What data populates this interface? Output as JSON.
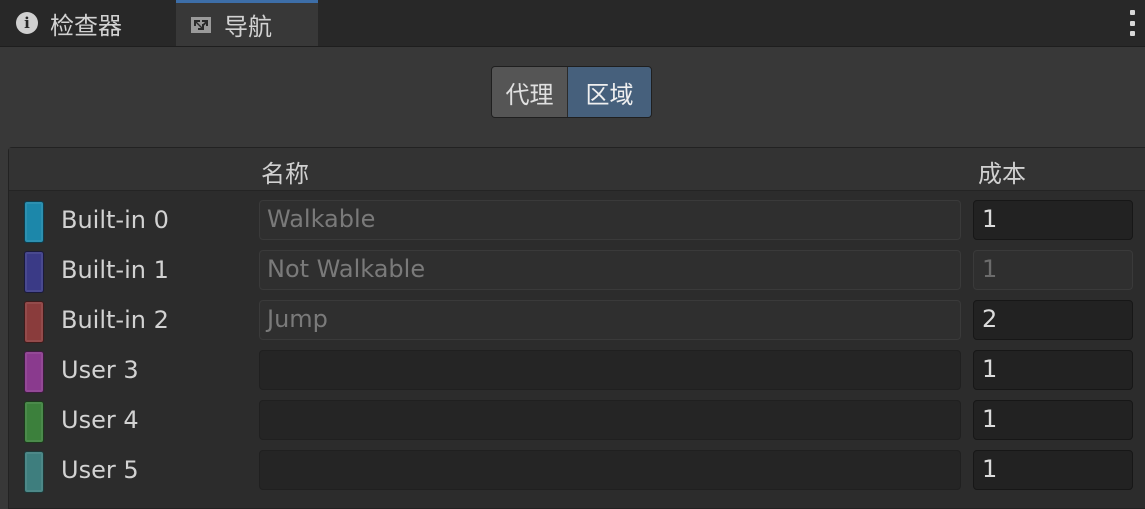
{
  "tabs": {
    "inspector": "检查器",
    "navigation": "导航"
  },
  "segments": {
    "agents": "代理",
    "areas": "区域"
  },
  "table": {
    "col_name": "名称",
    "col_cost": "成本",
    "rows": [
      {
        "label": "Built-in 0",
        "name": "Walkable",
        "cost": "1",
        "color": "#1c87aa",
        "name_readonly": true,
        "cost_disabled": false
      },
      {
        "label": "Built-in 1",
        "name": "Not Walkable",
        "cost": "1",
        "color": "#3a3a86",
        "name_readonly": true,
        "cost_disabled": true
      },
      {
        "label": "Built-in 2",
        "name": "Jump",
        "cost": "2",
        "color": "#8a3c3c",
        "name_readonly": true,
        "cost_disabled": false
      },
      {
        "label": "User 3",
        "name": "",
        "cost": "1",
        "color": "#8a3a8e",
        "name_readonly": false,
        "cost_disabled": false
      },
      {
        "label": "User 4",
        "name": "",
        "cost": "1",
        "color": "#3c803c",
        "name_readonly": false,
        "cost_disabled": false
      },
      {
        "label": "User 5",
        "name": "",
        "cost": "1",
        "color": "#3e7e7e",
        "name_readonly": false,
        "cost_disabled": false
      }
    ]
  }
}
